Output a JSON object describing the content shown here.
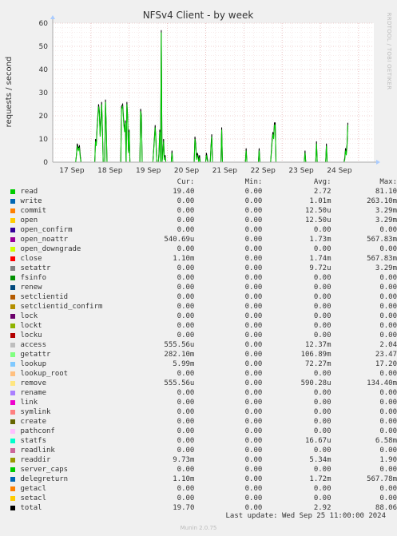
{
  "chart_data": {
    "type": "line",
    "title": "NFSv4 Client - by week",
    "ylabel": "requests / second",
    "side_label": "RRDTOOL / TOBI OETIKER",
    "ylim": [
      0,
      60
    ],
    "yticks": [
      0,
      10,
      20,
      30,
      40,
      50,
      60
    ],
    "xlim": [
      0,
      8.4
    ],
    "xticks": [
      {
        "label": "17 Sep",
        "x": 0.5
      },
      {
        "label": "18 Sep",
        "x": 1.5
      },
      {
        "label": "19 Sep",
        "x": 2.5
      },
      {
        "label": "20 Sep",
        "x": 3.5
      },
      {
        "label": "21 Sep",
        "x": 4.5
      },
      {
        "label": "22 Sep",
        "x": 5.5
      },
      {
        "label": "23 Sep",
        "x": 6.5
      },
      {
        "label": "24 Sep",
        "x": 7.5
      }
    ],
    "series": [
      {
        "name": "total",
        "color": "#000000",
        "points": [
          [
            0,
            0
          ],
          [
            0.6,
            0
          ],
          [
            0.62,
            3
          ],
          [
            0.64,
            8
          ],
          [
            0.67,
            6
          ],
          [
            0.7,
            7
          ],
          [
            0.72,
            3
          ],
          [
            0.74,
            0
          ],
          [
            1.1,
            0
          ],
          [
            1.12,
            10
          ],
          [
            1.14,
            8
          ],
          [
            1.16,
            15
          ],
          [
            1.18,
            20
          ],
          [
            1.2,
            25
          ],
          [
            1.22,
            22
          ],
          [
            1.24,
            12
          ],
          [
            1.26,
            18
          ],
          [
            1.28,
            26
          ],
          [
            1.3,
            15
          ],
          [
            1.32,
            0
          ],
          [
            1.36,
            0
          ],
          [
            1.38,
            27
          ],
          [
            1.4,
            16
          ],
          [
            1.42,
            0
          ],
          [
            1.78,
            0
          ],
          [
            1.8,
            24
          ],
          [
            1.83,
            25
          ],
          [
            1.86,
            17
          ],
          [
            1.88,
            14
          ],
          [
            1.9,
            18
          ],
          [
            1.92,
            0
          ],
          [
            1.94,
            26
          ],
          [
            1.96,
            20
          ],
          [
            1.98,
            5
          ],
          [
            2.0,
            14
          ],
          [
            2.02,
            0
          ],
          [
            2.28,
            0
          ],
          [
            2.3,
            23
          ],
          [
            2.32,
            20
          ],
          [
            2.34,
            0
          ],
          [
            2.62,
            0
          ],
          [
            2.65,
            8
          ],
          [
            2.68,
            16
          ],
          [
            2.7,
            10
          ],
          [
            2.72,
            0
          ],
          [
            2.76,
            0
          ],
          [
            2.78,
            4
          ],
          [
            2.8,
            14
          ],
          [
            2.82,
            0
          ],
          [
            2.84,
            57
          ],
          [
            2.86,
            0
          ],
          [
            2.88,
            4
          ],
          [
            2.9,
            10
          ],
          [
            2.92,
            2
          ],
          [
            2.94,
            3
          ],
          [
            2.96,
            0
          ],
          [
            3.1,
            0
          ],
          [
            3.12,
            5
          ],
          [
            3.14,
            0
          ],
          [
            3.7,
            0
          ],
          [
            3.72,
            11
          ],
          [
            3.74,
            8
          ],
          [
            3.76,
            2
          ],
          [
            3.78,
            4
          ],
          [
            3.8,
            3
          ],
          [
            3.82,
            1
          ],
          [
            3.84,
            3
          ],
          [
            3.86,
            0
          ],
          [
            4.0,
            0
          ],
          [
            4.02,
            4
          ],
          [
            4.04,
            2
          ],
          [
            4.06,
            0
          ],
          [
            4.12,
            0
          ],
          [
            4.14,
            7
          ],
          [
            4.16,
            12
          ],
          [
            4.18,
            0
          ],
          [
            4.4,
            0
          ],
          [
            4.42,
            15
          ],
          [
            4.44,
            0
          ],
          [
            5.04,
            0
          ],
          [
            5.06,
            6
          ],
          [
            5.08,
            0
          ],
          [
            5.38,
            0
          ],
          [
            5.4,
            6
          ],
          [
            5.42,
            0
          ],
          [
            5.7,
            0
          ],
          [
            5.72,
            5
          ],
          [
            5.74,
            10
          ],
          [
            5.76,
            13
          ],
          [
            5.78,
            11
          ],
          [
            5.8,
            17
          ],
          [
            5.82,
            17
          ],
          [
            5.84,
            0
          ],
          [
            6.58,
            0
          ],
          [
            6.6,
            5
          ],
          [
            6.62,
            0
          ],
          [
            6.88,
            0
          ],
          [
            6.9,
            9
          ],
          [
            6.92,
            0
          ],
          [
            7.14,
            0
          ],
          [
            7.16,
            8
          ],
          [
            7.18,
            0
          ],
          [
            7.62,
            0
          ],
          [
            7.64,
            2
          ],
          [
            7.66,
            6
          ],
          [
            7.68,
            4
          ],
          [
            7.7,
            8
          ],
          [
            7.72,
            17
          ]
        ]
      },
      {
        "name": "read",
        "color": "#00cc00",
        "points": [
          [
            0,
            0
          ],
          [
            0.6,
            0
          ],
          [
            0.62,
            3
          ],
          [
            0.64,
            7
          ],
          [
            0.67,
            5
          ],
          [
            0.7,
            6
          ],
          [
            0.72,
            2
          ],
          [
            0.74,
            0
          ],
          [
            1.1,
            0
          ],
          [
            1.12,
            9
          ],
          [
            1.14,
            7
          ],
          [
            1.16,
            14
          ],
          [
            1.18,
            19
          ],
          [
            1.2,
            24
          ],
          [
            1.22,
            21
          ],
          [
            1.24,
            11
          ],
          [
            1.26,
            17
          ],
          [
            1.28,
            25
          ],
          [
            1.3,
            14
          ],
          [
            1.32,
            0
          ],
          [
            1.36,
            0
          ],
          [
            1.38,
            26
          ],
          [
            1.4,
            15
          ],
          [
            1.42,
            0
          ],
          [
            1.78,
            0
          ],
          [
            1.8,
            23
          ],
          [
            1.83,
            24
          ],
          [
            1.86,
            16
          ],
          [
            1.88,
            13
          ],
          [
            1.9,
            17
          ],
          [
            1.92,
            0
          ],
          [
            1.94,
            25
          ],
          [
            1.96,
            19
          ],
          [
            1.98,
            4
          ],
          [
            2.0,
            13
          ],
          [
            2.02,
            0
          ],
          [
            2.28,
            0
          ],
          [
            2.3,
            22
          ],
          [
            2.32,
            19
          ],
          [
            2.34,
            0
          ],
          [
            2.62,
            0
          ],
          [
            2.65,
            7
          ],
          [
            2.68,
            15
          ],
          [
            2.7,
            9
          ],
          [
            2.72,
            0
          ],
          [
            2.76,
            0
          ],
          [
            2.78,
            3
          ],
          [
            2.8,
            13
          ],
          [
            2.82,
            0
          ],
          [
            2.84,
            56
          ],
          [
            2.86,
            0
          ],
          [
            2.88,
            3
          ],
          [
            2.9,
            9
          ],
          [
            2.92,
            1
          ],
          [
            2.94,
            2
          ],
          [
            2.96,
            0
          ],
          [
            3.1,
            0
          ],
          [
            3.12,
            4
          ],
          [
            3.14,
            0
          ],
          [
            3.7,
            0
          ],
          [
            3.72,
            10
          ],
          [
            3.74,
            7
          ],
          [
            3.76,
            1
          ],
          [
            3.78,
            3
          ],
          [
            3.8,
            2
          ],
          [
            3.82,
            0
          ],
          [
            3.84,
            2
          ],
          [
            3.86,
            0
          ],
          [
            4.0,
            0
          ],
          [
            4.02,
            3
          ],
          [
            4.04,
            1
          ],
          [
            4.06,
            0
          ],
          [
            4.12,
            0
          ],
          [
            4.14,
            6
          ],
          [
            4.16,
            11
          ],
          [
            4.18,
            0
          ],
          [
            4.4,
            0
          ],
          [
            4.42,
            14
          ],
          [
            4.44,
            0
          ],
          [
            5.04,
            0
          ],
          [
            5.06,
            5
          ],
          [
            5.08,
            0
          ],
          [
            5.38,
            0
          ],
          [
            5.4,
            5
          ],
          [
            5.42,
            0
          ],
          [
            5.7,
            0
          ],
          [
            5.72,
            4
          ],
          [
            5.74,
            9
          ],
          [
            5.76,
            12
          ],
          [
            5.78,
            10
          ],
          [
            5.8,
            16
          ],
          [
            5.82,
            16
          ],
          [
            5.84,
            0
          ],
          [
            6.58,
            0
          ],
          [
            6.6,
            4
          ],
          [
            6.62,
            0
          ],
          [
            6.88,
            0
          ],
          [
            6.9,
            8
          ],
          [
            6.92,
            0
          ],
          [
            7.14,
            0
          ],
          [
            7.16,
            7
          ],
          [
            7.18,
            0
          ],
          [
            7.62,
            0
          ],
          [
            7.64,
            1
          ],
          [
            7.66,
            5
          ],
          [
            7.68,
            3
          ],
          [
            7.7,
            7
          ],
          [
            7.72,
            16
          ]
        ]
      }
    ]
  },
  "legend": {
    "headers": {
      "cur": "Cur:",
      "min": "Min:",
      "avg": "Avg:",
      "max": "Max:"
    },
    "rows": [
      {
        "name": "read",
        "color": "#00cc00",
        "cur": "19.40",
        "min": "0.00",
        "avg": "2.72",
        "max": "81.10"
      },
      {
        "name": "write",
        "color": "#0066b3",
        "cur": "0.00",
        "min": "0.00",
        "avg": "1.01m",
        "max": "263.10m"
      },
      {
        "name": "commit",
        "color": "#ff8000",
        "cur": "0.00",
        "min": "0.00",
        "avg": "12.50u",
        "max": "3.29m"
      },
      {
        "name": "open",
        "color": "#ffcc00",
        "cur": "0.00",
        "min": "0.00",
        "avg": "12.50u",
        "max": "3.29m"
      },
      {
        "name": "open_confirm",
        "color": "#330099",
        "cur": "0.00",
        "min": "0.00",
        "avg": "0.00",
        "max": "0.00"
      },
      {
        "name": "open_noattr",
        "color": "#990099",
        "cur": "540.69u",
        "min": "0.00",
        "avg": "1.73m",
        "max": "567.83m"
      },
      {
        "name": "open_downgrade",
        "color": "#ccff00",
        "cur": "0.00",
        "min": "0.00",
        "avg": "0.00",
        "max": "0.00"
      },
      {
        "name": "close",
        "color": "#ff0000",
        "cur": "1.10m",
        "min": "0.00",
        "avg": "1.74m",
        "max": "567.83m"
      },
      {
        "name": "setattr",
        "color": "#808080",
        "cur": "0.00",
        "min": "0.00",
        "avg": "9.72u",
        "max": "3.29m"
      },
      {
        "name": "fsinfo",
        "color": "#008f00",
        "cur": "0.00",
        "min": "0.00",
        "avg": "0.00",
        "max": "0.00"
      },
      {
        "name": "renew",
        "color": "#00487d",
        "cur": "0.00",
        "min": "0.00",
        "avg": "0.00",
        "max": "0.00"
      },
      {
        "name": "setclientid",
        "color": "#b35a00",
        "cur": "0.00",
        "min": "0.00",
        "avg": "0.00",
        "max": "0.00"
      },
      {
        "name": "setclientid_confirm",
        "color": "#b38f00",
        "cur": "0.00",
        "min": "0.00",
        "avg": "0.00",
        "max": "0.00"
      },
      {
        "name": "lock",
        "color": "#6b006b",
        "cur": "0.00",
        "min": "0.00",
        "avg": "0.00",
        "max": "0.00"
      },
      {
        "name": "lockt",
        "color": "#8fb300",
        "cur": "0.00",
        "min": "0.00",
        "avg": "0.00",
        "max": "0.00"
      },
      {
        "name": "locku",
        "color": "#b30000",
        "cur": "0.00",
        "min": "0.00",
        "avg": "0.00",
        "max": "0.00"
      },
      {
        "name": "access",
        "color": "#bebebe",
        "cur": "555.56u",
        "min": "0.00",
        "avg": "12.37m",
        "max": "2.04"
      },
      {
        "name": "getattr",
        "color": "#80ff80",
        "cur": "282.10m",
        "min": "0.00",
        "avg": "106.89m",
        "max": "23.47"
      },
      {
        "name": "lookup",
        "color": "#80c9ff",
        "cur": "5.99m",
        "min": "0.00",
        "avg": "72.27m",
        "max": "17.20"
      },
      {
        "name": "lookup_root",
        "color": "#ffc080",
        "cur": "0.00",
        "min": "0.00",
        "avg": "0.00",
        "max": "0.00"
      },
      {
        "name": "remove",
        "color": "#ffe680",
        "cur": "555.56u",
        "min": "0.00",
        "avg": "590.28u",
        "max": "134.40m"
      },
      {
        "name": "rename",
        "color": "#aa80ff",
        "cur": "0.00",
        "min": "0.00",
        "avg": "0.00",
        "max": "0.00"
      },
      {
        "name": "link",
        "color": "#ee00cc",
        "cur": "0.00",
        "min": "0.00",
        "avg": "0.00",
        "max": "0.00"
      },
      {
        "name": "symlink",
        "color": "#ff8080",
        "cur": "0.00",
        "min": "0.00",
        "avg": "0.00",
        "max": "0.00"
      },
      {
        "name": "create",
        "color": "#666600",
        "cur": "0.00",
        "min": "0.00",
        "avg": "0.00",
        "max": "0.00"
      },
      {
        "name": "pathconf",
        "color": "#ffbfff",
        "cur": "0.00",
        "min": "0.00",
        "avg": "0.00",
        "max": "0.00"
      },
      {
        "name": "statfs",
        "color": "#00ffcc",
        "cur": "0.00",
        "min": "0.00",
        "avg": "16.67u",
        "max": "6.58m"
      },
      {
        "name": "readlink",
        "color": "#cc6699",
        "cur": "0.00",
        "min": "0.00",
        "avg": "0.00",
        "max": "0.00"
      },
      {
        "name": "readdir",
        "color": "#999900",
        "cur": "9.73m",
        "min": "0.00",
        "avg": "5.34m",
        "max": "1.90"
      },
      {
        "name": "server_caps",
        "color": "#00cc00",
        "cur": "0.00",
        "min": "0.00",
        "avg": "0.00",
        "max": "0.00"
      },
      {
        "name": "delegreturn",
        "color": "#0066b3",
        "cur": "1.10m",
        "min": "0.00",
        "avg": "1.72m",
        "max": "567.78m"
      },
      {
        "name": "getacl",
        "color": "#ff8000",
        "cur": "0.00",
        "min": "0.00",
        "avg": "0.00",
        "max": "0.00"
      },
      {
        "name": "setacl",
        "color": "#ffcc00",
        "cur": "0.00",
        "min": "0.00",
        "avg": "0.00",
        "max": "0.00"
      },
      {
        "name": "total",
        "color": "#000000",
        "cur": "19.70",
        "min": "0.00",
        "avg": "2.92",
        "max": "88.06"
      }
    ]
  },
  "last_update": "Last update:  Wed Sep 25 11:00:00 2024",
  "footer": "Munin 2.0.75"
}
